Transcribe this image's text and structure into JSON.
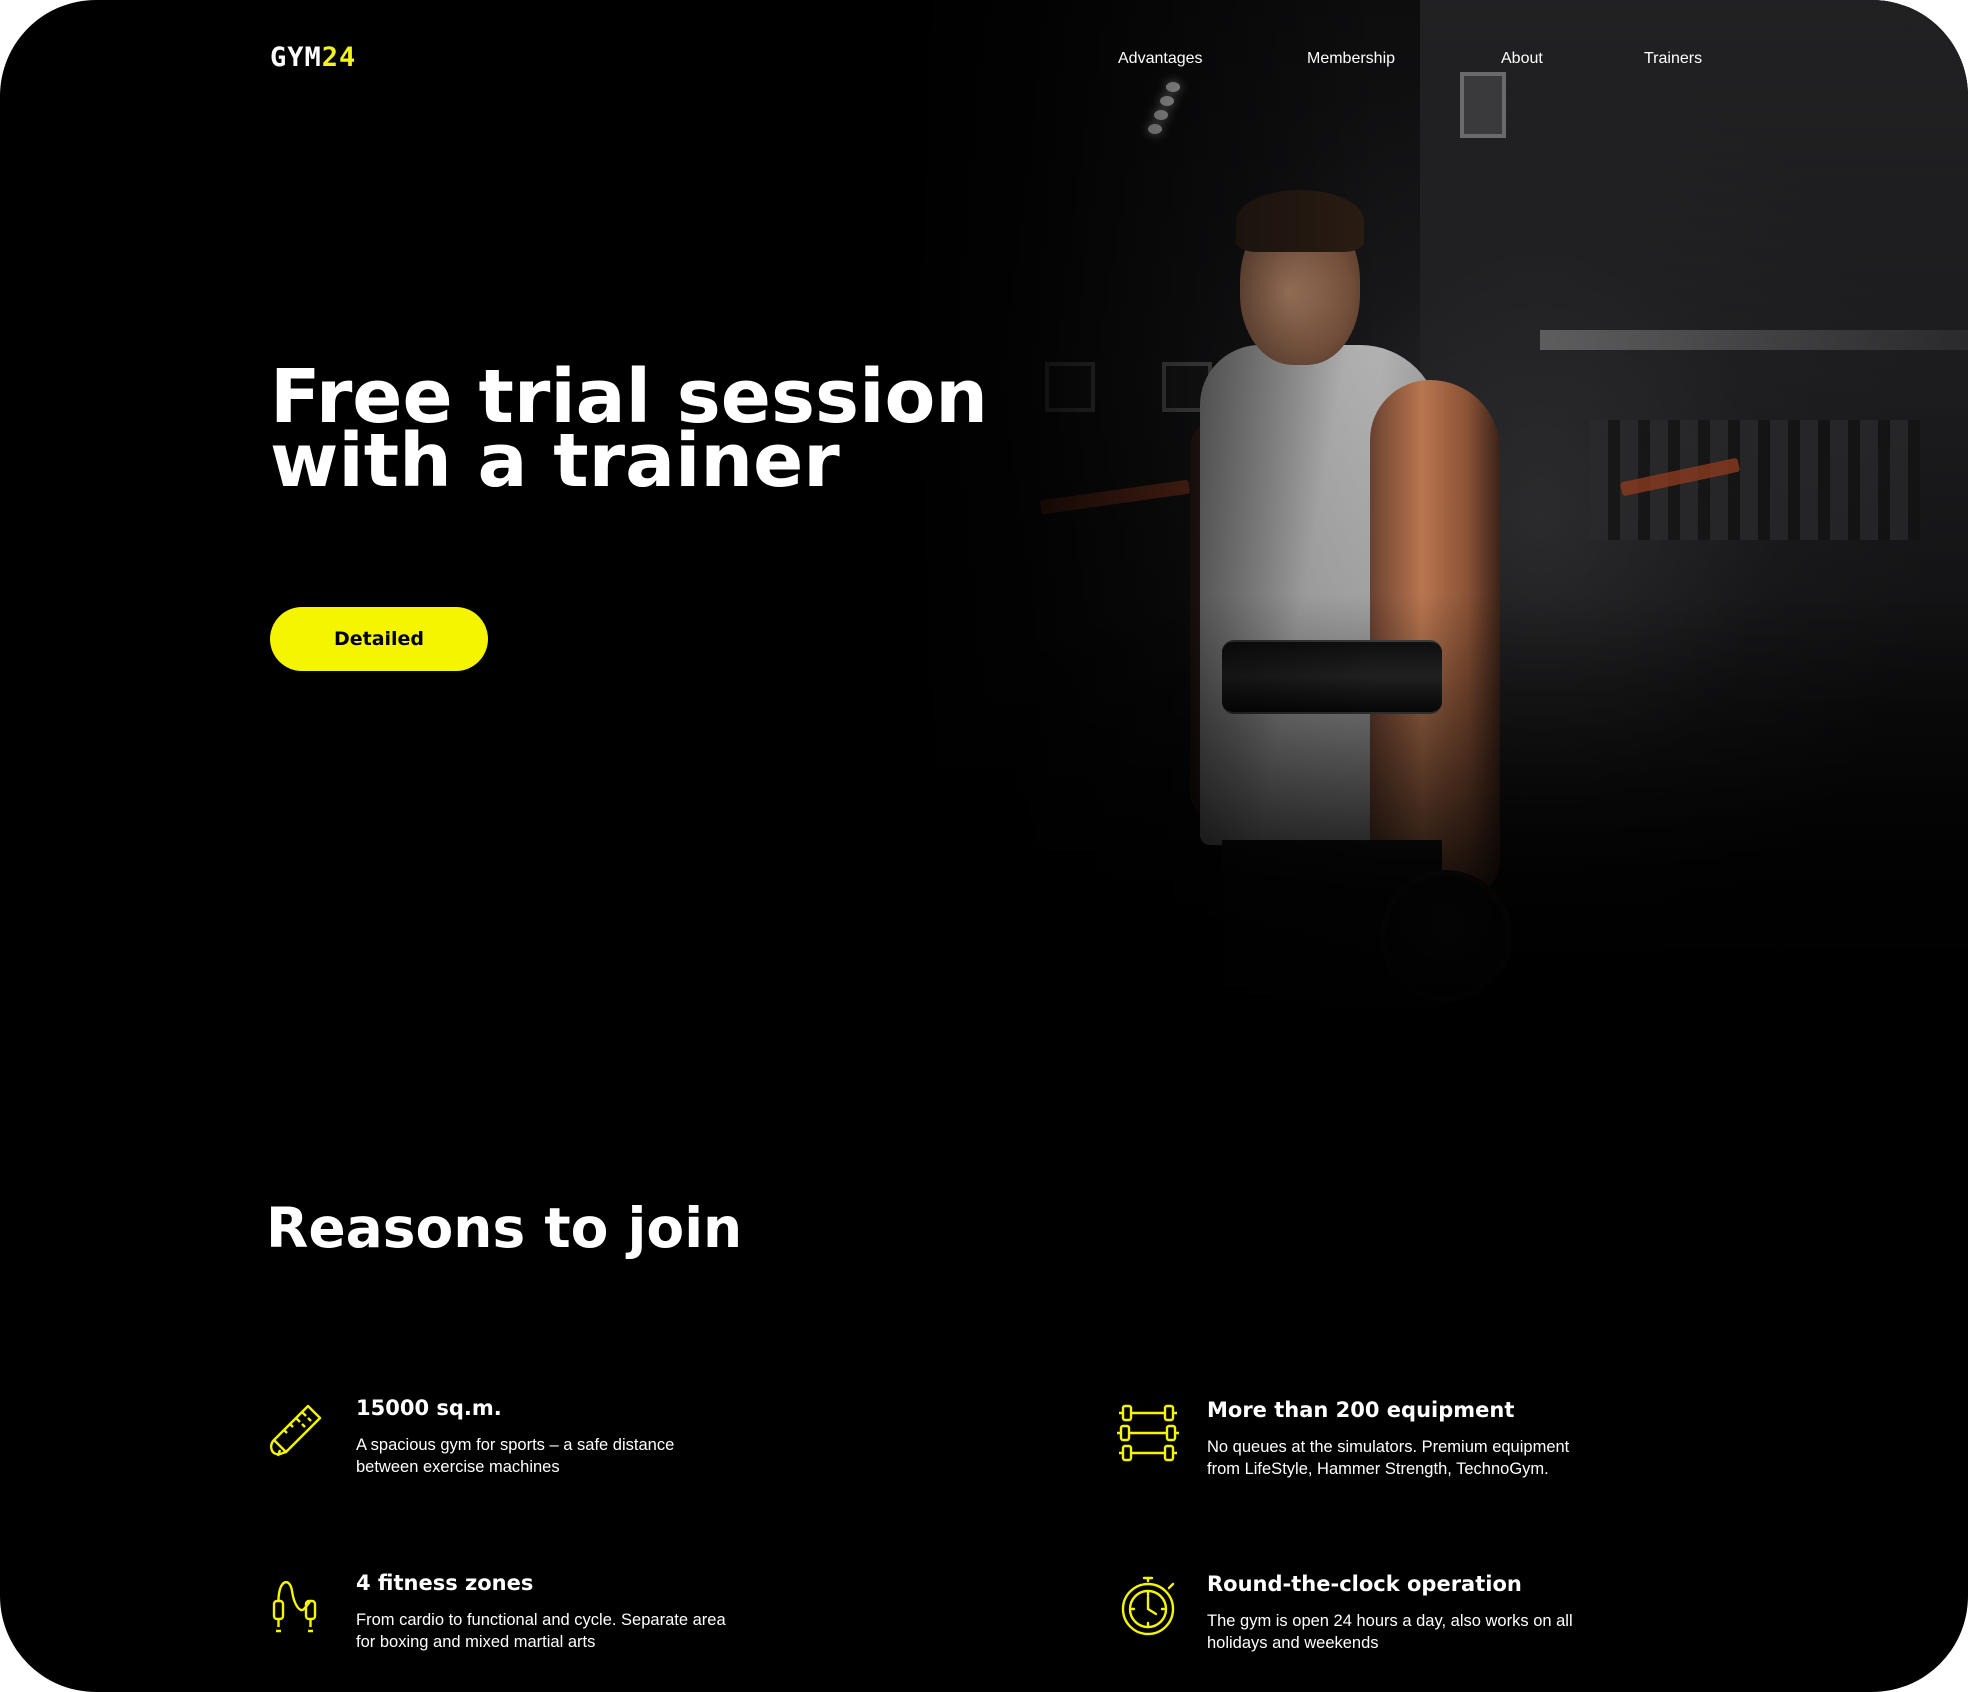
{
  "header": {
    "logo_main": "GYM",
    "logo_accent": "24",
    "nav": [
      "Advantages",
      "Membership",
      "About",
      "Trainers"
    ]
  },
  "hero": {
    "title_line1": "Free trial session",
    "title_line2": "with a trainer",
    "cta_label": "Detailed"
  },
  "reasons": {
    "title": "Reasons to join",
    "items": [
      {
        "icon": "measuring-tape-icon",
        "title": "15000 sq.m.",
        "desc_line1": "A spacious gym for sports – a safe distance",
        "desc_line2": "between exercise machines"
      },
      {
        "icon": "dumbbells-icon",
        "title": "More than 200 equipment",
        "desc_line1": "No queues at the simulators. Premium equipment",
        "desc_line2": "from LifeStyle, Hammer Strength, TechnoGym."
      },
      {
        "icon": "jump-rope-icon",
        "title": "4 fitness zones",
        "desc_line1": "From cardio to functional and cycle. Separate area",
        "desc_line2": "for boxing and mixed martial arts"
      },
      {
        "icon": "clock-icon",
        "title": "Round-the-clock operation",
        "desc_line1": "The gym is open 24 hours a day, also works on all",
        "desc_line2": "holidays and weekends"
      }
    ]
  },
  "colors": {
    "background": "#000000",
    "accent": "#f5f500",
    "text": "#ffffff"
  }
}
